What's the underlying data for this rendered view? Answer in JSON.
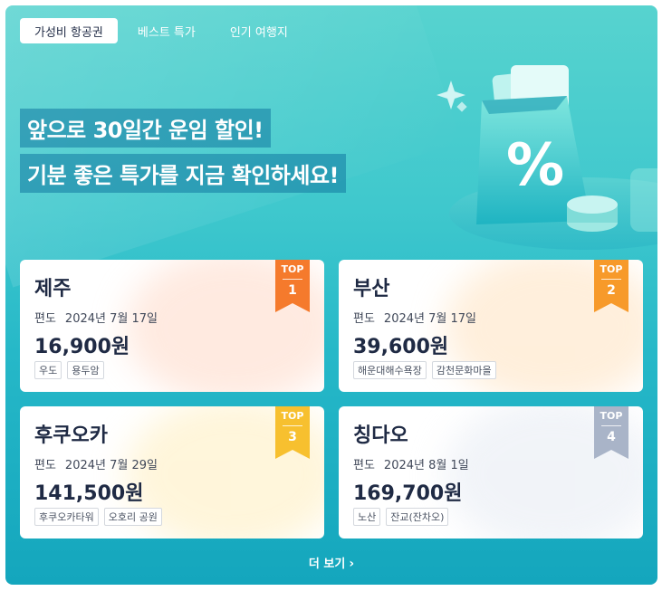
{
  "tabs": [
    {
      "label": "가성비 항공권",
      "active": true
    },
    {
      "label": "베스트 특가",
      "active": false
    },
    {
      "label": "인기 여행지",
      "active": false
    }
  ],
  "headline": {
    "line1": "앞으로 30일간 운임 할인!",
    "line2": "기분 좋은 특가를 지금 확인하세요!"
  },
  "hero_icon": "shopping-bag-percent-icon",
  "ribbon_top_label": "TOP",
  "cards": [
    {
      "rank": "1",
      "city": "제주",
      "trip": "편도",
      "date": "2024년 7월 17일",
      "price": "16,900원",
      "tags": [
        "우도",
        "용두암"
      ],
      "ribbon_color": "#f57a2c",
      "glow": "#ffd9c7"
    },
    {
      "rank": "2",
      "city": "부산",
      "trip": "편도",
      "date": "2024년 7월 17일",
      "price": "39,600원",
      "tags": [
        "해운대해수욕장",
        "감천문화마을"
      ],
      "ribbon_color": "#f79a2a",
      "glow": "#ffe2bf"
    },
    {
      "rank": "3",
      "city": "후쿠오카",
      "trip": "편도",
      "date": "2024년 7월 29일",
      "price": "141,500원",
      "tags": [
        "후쿠오카타워",
        "오호리 공원"
      ],
      "ribbon_color": "#f7c02f",
      "glow": "#ffeebd"
    },
    {
      "rank": "4",
      "city": "칭다오",
      "trip": "편도",
      "date": "2024년 8월 1일",
      "price": "169,700원",
      "tags": [
        "노산",
        "잔교(잔차오)"
      ],
      "ribbon_color": "#a9b4c8",
      "glow": "#e6ebf3"
    }
  ],
  "more": {
    "label": "더 보기",
    "icon": "chevron-right-icon"
  }
}
